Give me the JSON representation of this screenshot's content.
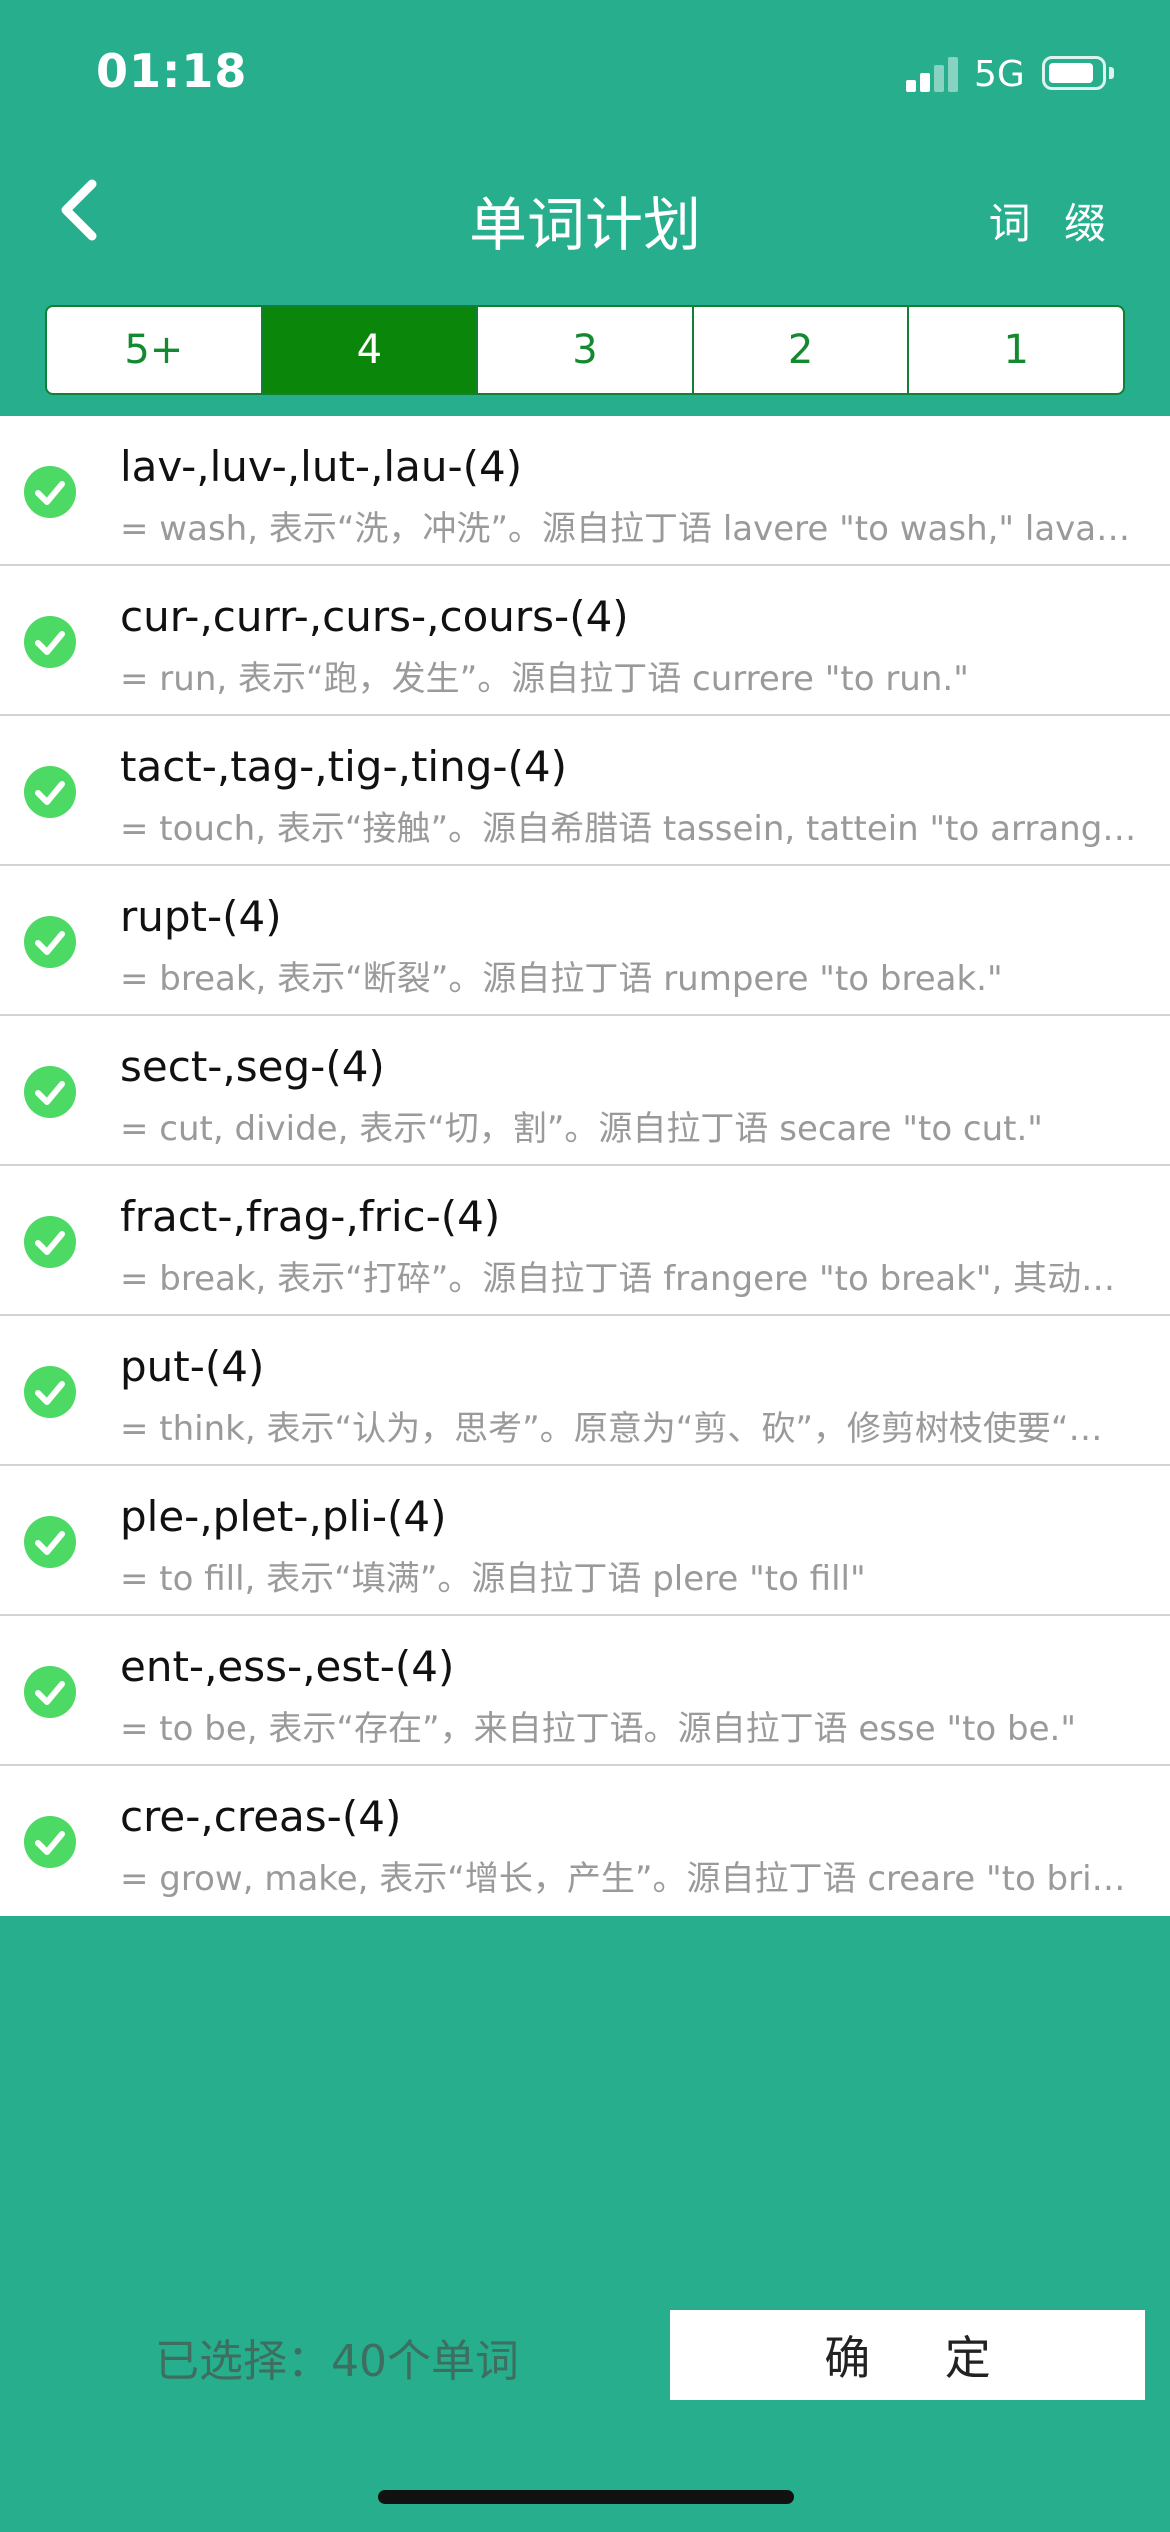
{
  "status_bar": {
    "time": "01:18",
    "network": "5G"
  },
  "nav": {
    "title": "单词计划",
    "right_button": "词 缀"
  },
  "tabs": [
    "5+",
    "4",
    "3",
    "2",
    "1"
  ],
  "active_tab": "4",
  "items": [
    {
      "title": "lav-,luv-,lut-,lau-(4)",
      "desc": "= wash, 表示“洗，冲洗”。源自拉丁语 lavere \"to wash,\" lavar…"
    },
    {
      "title": "cur-,curr-,curs-,cours-(4)",
      "desc": "= run, 表示“跑，发生”。源自拉丁语 currere \"to run.\""
    },
    {
      "title": "tact-,tag-,tig-,ting-(4)",
      "desc": "= touch, 表示“接触”。源自希腊语 tassein, tattein \"to arrang…"
    },
    {
      "title": "rupt-(4)",
      "desc": "= break, 表示“断裂”。源自拉丁语 rumpere \"to break.\""
    },
    {
      "title": "sect-,seg-(4)",
      "desc": "= cut, divide, 表示“切，割”。源自拉丁语 secare \"to cut.\""
    },
    {
      "title": "fract-,frag-,fric-(4)",
      "desc": "= break, 表示“打碎”。源自拉丁语 frangere \"to break\", 其动…"
    },
    {
      "title": "put-(4)",
      "desc": "= think, 表示“认为，思考”。原意为“剪、砍”，修剪树枝使要“…"
    },
    {
      "title": "ple-,plet-,pli-(4)",
      "desc": "= to fill, 表示“填满”。源自拉丁语 plere \"to fill\""
    },
    {
      "title": "ent-,ess-,est-(4)",
      "desc": "= to be, 表示“存在”，来自拉丁语。源自拉丁语 esse \"to be.\""
    },
    {
      "title": "cre-,creas-(4)",
      "desc": "= grow, make, 表示“增长，产生”。源自拉丁语 creare \"to bri…"
    }
  ],
  "footer": {
    "selected_text": "已选择：40个单词",
    "confirm_label": "确 定"
  },
  "colors": {
    "background": "#26ae8d",
    "segment_active": "#0a870b",
    "segment_text": "#138a2f",
    "check": "#4cd964"
  },
  "icons": {
    "back": "chevron-left-icon",
    "check": "check-circle-icon",
    "signal": "signal-icon",
    "battery": "battery-icon"
  }
}
